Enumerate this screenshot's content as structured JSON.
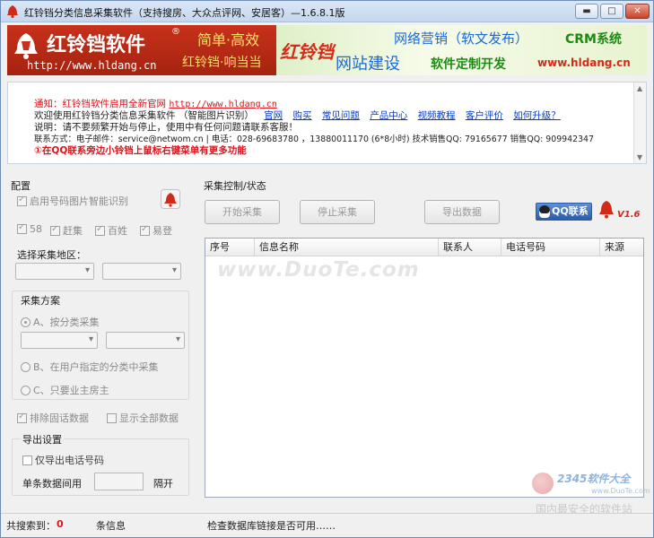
{
  "window": {
    "title": "红铃铛分类信息采集软件（支持搜房、大众点评网、安居客）—1.6.8.1版",
    "minimize": "▬",
    "maximize": "□",
    "close": "✕"
  },
  "banner": {
    "brand": "红铃铛软件",
    "registered": "®",
    "slogan1": "简单·高效",
    "slogan2": "红铃铛·响当当",
    "url_left": "http://www.hldang.cn",
    "brand2": "红铃铛",
    "service1": "网络营销（软文发布）",
    "service2": "CRM系统",
    "service3": "网站建设",
    "service4": "软件定制开发",
    "url_right": "www.hldang.cn"
  },
  "notice": {
    "line1_prefix": "通知：红铃铛软件启用全新官网 ",
    "line1_url": "http://www.hldang.cn",
    "line2_text": "欢迎使用红铃铛分类信息采集软件  （智能图片识别）",
    "links": [
      "官网",
      "购买",
      "常见问题",
      "产品中心",
      "视频教程",
      "客户评价",
      "如何升级？"
    ],
    "line3": "说明：请不要频繁开始与停止，使用中有任何问题请联系客服！",
    "line4": "联系方式：电子邮件：service@netwom.cn | 电话：028-69683780 ，13880011170 (6*8小时) 技术销售QQ: 79165677 销售QQ: 909942347",
    "line5": "①在QQ联系旁边小铃铛上鼠标右键菜单有更多功能"
  },
  "config": {
    "group_label": "配置",
    "smart_recog": "启用号码图片智能识别",
    "sources": [
      "58",
      "赶集",
      "百姓",
      "易登"
    ],
    "region_label": "选择采集地区：",
    "plan_label": "采集方案",
    "plan_a": "A、按分类采集",
    "plan_b": "B、在用户指定的分类中采集",
    "plan_c": "C、只要业主房主",
    "exclude_dup": "排除固话数据",
    "show_all": "显示全部数据",
    "export_label": "导出设置",
    "export_phone_only": "仅导出电话号码",
    "interval_label": "单条数据间用",
    "separator_label": "隔开",
    "interval_value": ""
  },
  "control": {
    "group_label": "采集控制/状态",
    "start": "开始采集",
    "stop": "停止采集",
    "export": "导出数据",
    "qq_contact": "QQ联系",
    "version": "V1.6"
  },
  "table": {
    "columns": [
      "序号",
      "信息名称",
      "联系人",
      "电话号码",
      "来源"
    ],
    "rows": []
  },
  "watermark": "www.DuoTe.com",
  "status": {
    "found_label": "共搜索到：",
    "found_count": "0",
    "unit": "条信息",
    "message": "检查数据库链接是否可用……"
  },
  "corner_badge": {
    "brand": "2345软件大全",
    "url": "www.DuoTe.com",
    "slogan": "国内最安全的软件站"
  },
  "colors": {
    "accent_red": "#c7311a",
    "link_blue": "#0a3cc7",
    "notice_red": "#e0121b"
  }
}
